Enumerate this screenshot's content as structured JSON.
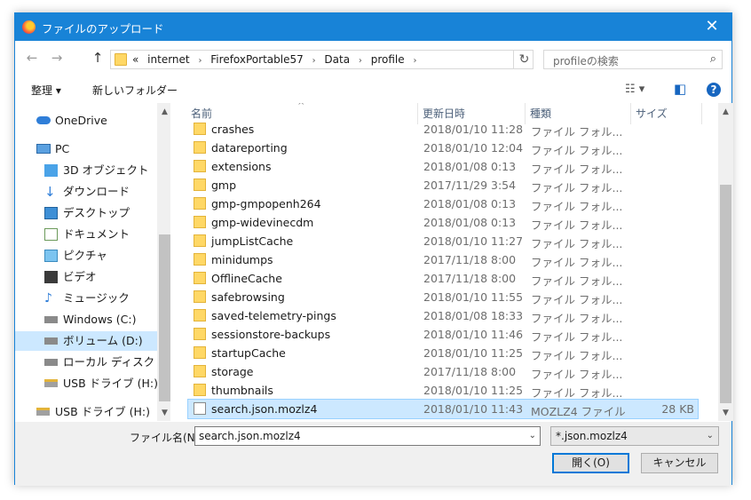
{
  "window": {
    "title": "ファイルのアップロード",
    "close_glyph": "✕",
    "accent_color": "#1883d7"
  },
  "nav": {
    "back_glyph": "←",
    "forward_glyph": "→",
    "up_glyph": "↑",
    "breadcrumb_prefix": "«",
    "breadcrumbs": [
      "internet",
      "FirefoxPortable57",
      "Data",
      "profile"
    ],
    "crumb_sep": "›",
    "addr_dropdown": "⌄",
    "refresh_glyph": "↻"
  },
  "search": {
    "placeholder": "profileの検索",
    "icon": "⌕"
  },
  "toolbar": {
    "organize_label": "整理 ▾",
    "new_folder_label": "新しいフォルダー",
    "view_glyph": "☷ ▾",
    "pane_glyph": "◧",
    "help_glyph": "?"
  },
  "sidebar": {
    "items": [
      {
        "label": "OneDrive",
        "icon": "cloud-icon",
        "indent": 0
      },
      {
        "label": "PC",
        "icon": "pc-icon",
        "indent": 0
      },
      {
        "label": "3D オブジェクト",
        "icon": "cube-icon",
        "indent": 1
      },
      {
        "label": "ダウンロード",
        "icon": "download-icon",
        "indent": 1
      },
      {
        "label": "デスクトップ",
        "icon": "desktop-icon",
        "indent": 1
      },
      {
        "label": "ドキュメント",
        "icon": "document-icon",
        "indent": 1
      },
      {
        "label": "ピクチャ",
        "icon": "picture-icon",
        "indent": 1
      },
      {
        "label": "ビデオ",
        "icon": "video-icon",
        "indent": 1
      },
      {
        "label": "ミュージック",
        "icon": "music-icon",
        "indent": 1
      },
      {
        "label": "Windows (C:)",
        "icon": "drive-icon",
        "indent": 1
      },
      {
        "label": "ボリューム (D:)",
        "icon": "drive-icon",
        "indent": 1,
        "selected": true
      },
      {
        "label": "ローカル ディスク (",
        "icon": "drive-icon",
        "indent": 1
      },
      {
        "label": "USB ドライブ (H:)",
        "icon": "usb-drive-icon",
        "indent": 1
      },
      {
        "label": "USB ドライブ (H:)",
        "icon": "usb-drive-icon",
        "indent": 0
      }
    ]
  },
  "columns": {
    "name": "名前",
    "date": "更新日時",
    "type": "種類",
    "size": "サイズ",
    "sort_glyph": "^"
  },
  "files": [
    {
      "name": "crashes",
      "date": "2018/01/10 11:28",
      "type": "ファイル フォル...",
      "size": "",
      "kind": "folder"
    },
    {
      "name": "datareporting",
      "date": "2018/01/10 12:04",
      "type": "ファイル フォル...",
      "size": "",
      "kind": "folder"
    },
    {
      "name": "extensions",
      "date": "2018/01/08 0:13",
      "type": "ファイル フォル...",
      "size": "",
      "kind": "folder"
    },
    {
      "name": "gmp",
      "date": "2017/11/29 3:54",
      "type": "ファイル フォル...",
      "size": "",
      "kind": "folder"
    },
    {
      "name": "gmp-gmpopenh264",
      "date": "2018/01/08 0:13",
      "type": "ファイル フォル...",
      "size": "",
      "kind": "folder"
    },
    {
      "name": "gmp-widevinecdm",
      "date": "2018/01/08 0:13",
      "type": "ファイル フォル...",
      "size": "",
      "kind": "folder"
    },
    {
      "name": "jumpListCache",
      "date": "2018/01/10 11:27",
      "type": "ファイル フォル...",
      "size": "",
      "kind": "folder"
    },
    {
      "name": "minidumps",
      "date": "2017/11/18 8:00",
      "type": "ファイル フォル...",
      "size": "",
      "kind": "folder"
    },
    {
      "name": "OfflineCache",
      "date": "2017/11/18 8:00",
      "type": "ファイル フォル...",
      "size": "",
      "kind": "folder"
    },
    {
      "name": "safebrowsing",
      "date": "2018/01/10 11:55",
      "type": "ファイル フォル...",
      "size": "",
      "kind": "folder"
    },
    {
      "name": "saved-telemetry-pings",
      "date": "2018/01/08 18:33",
      "type": "ファイル フォル...",
      "size": "",
      "kind": "folder"
    },
    {
      "name": "sessionstore-backups",
      "date": "2018/01/10 11:46",
      "type": "ファイル フォル...",
      "size": "",
      "kind": "folder"
    },
    {
      "name": "startupCache",
      "date": "2018/01/10 11:25",
      "type": "ファイル フォル...",
      "size": "",
      "kind": "folder"
    },
    {
      "name": "storage",
      "date": "2017/11/18 8:00",
      "type": "ファイル フォル...",
      "size": "",
      "kind": "folder"
    },
    {
      "name": "thumbnails",
      "date": "2018/01/10 11:25",
      "type": "ファイル フォル...",
      "size": "",
      "kind": "folder"
    },
    {
      "name": "search.json.mozlz4",
      "date": "2018/01/10 11:43",
      "type": "MOZLZ4 ファイル",
      "size": "28 KB",
      "kind": "file",
      "selected": true
    }
  ],
  "footer": {
    "filename_label": "ファイル名(N):",
    "filename_value": "search.json.mozlz4",
    "filetype_value": "*.json.mozlz4",
    "dropdown_glyph": "⌄",
    "open_label": "開く(O)",
    "cancel_label": "キャンセル"
  }
}
